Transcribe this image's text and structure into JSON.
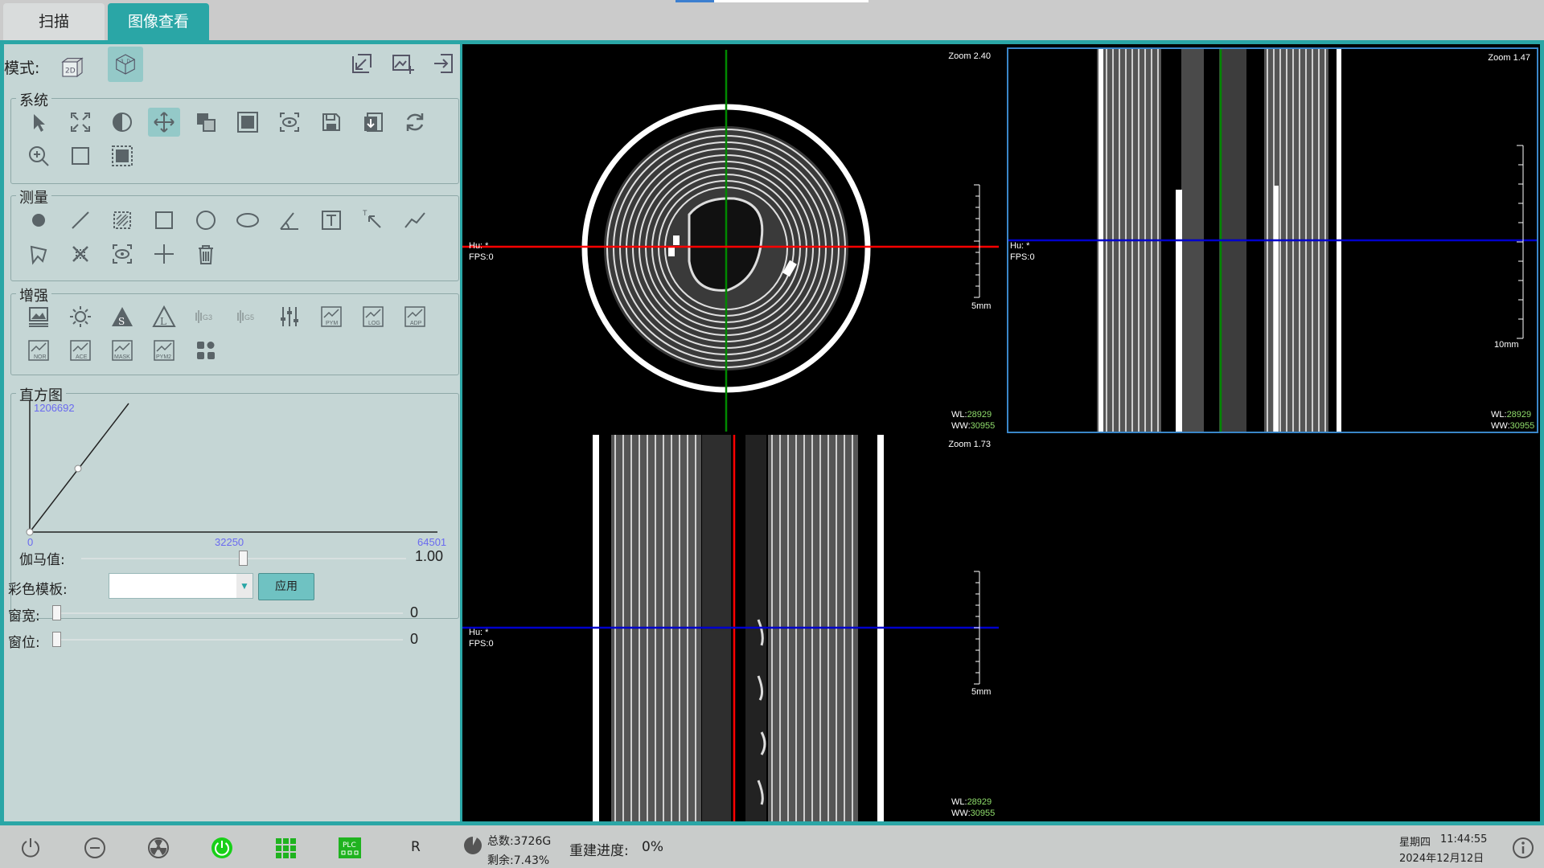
{
  "tabs": [
    {
      "label": "扫描",
      "active": false
    },
    {
      "label": "图像查看",
      "active": true
    }
  ],
  "left_panel": {
    "mode_label": "模式:",
    "mode_buttons": [
      "2D",
      "3D"
    ],
    "groups": {
      "system": "系统",
      "measure": "测量",
      "enhance": "增强",
      "histogram": "直方图"
    },
    "enhance_icons": [
      "G3",
      "G5",
      "PYM",
      "LOG",
      "ADP",
      "NOR",
      "ACE",
      "MASK",
      "PYM2"
    ],
    "histogram": {
      "max_count": "1206692",
      "axis_min": "0",
      "axis_mid": "32250",
      "axis_max": "64501"
    },
    "gamma": {
      "label": "伽马值:",
      "value": "1.00",
      "position": 0.5
    },
    "color_template": {
      "label": "彩色模板:",
      "value": "",
      "apply": "应用"
    },
    "window_width": {
      "label": "窗宽:",
      "value": "0"
    },
    "window_level": {
      "label": "窗位:",
      "value": "0"
    }
  },
  "views": {
    "axial": {
      "zoom": "Zoom 2.40",
      "hu": "Hu: *",
      "fps": "FPS:0",
      "scale": "5mm",
      "wl_label": "WL:",
      "wl": "28929",
      "ww_label": "WW:",
      "ww": "30955"
    },
    "coronal": {
      "zoom": "Zoom 1.47",
      "hu": "Hu: *",
      "fps": "FPS:0",
      "scale": "10mm",
      "wl_label": "WL:",
      "wl": "28929",
      "ww_label": "WW:",
      "ww": "30955"
    },
    "sagittal": {
      "zoom": "Zoom 1.73",
      "hu": "Hu: *",
      "fps": "FPS:0",
      "scale": "5mm",
      "wl_label": "WL:",
      "wl": "28929",
      "ww_label": "WW:",
      "ww": "30955"
    }
  },
  "status_bar": {
    "r_label": "R",
    "disk_total": "总数:3726G",
    "disk_remaining": "剩余:7.43%",
    "disk_remaining_fraction": 0.0743,
    "rebuild_label": "重建进度:",
    "rebuild_value": "0%",
    "weekday": "星期四",
    "time": "11:44:55",
    "date": "2024年12月12日"
  },
  "colors": {
    "accent": "#2aa6a6",
    "crosshair_red": "#ff0000",
    "crosshair_green": "#008800",
    "crosshair_blue": "#0000cc",
    "power_on": "#18d018"
  }
}
